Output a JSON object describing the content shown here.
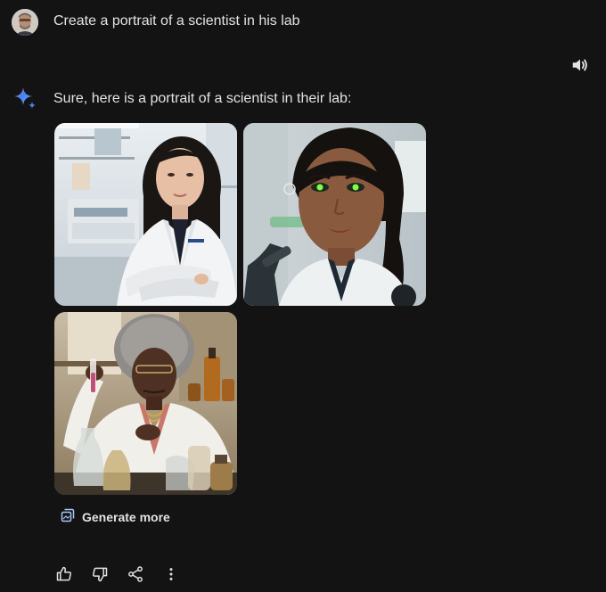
{
  "user": {
    "prompt": "Create a portrait of a scientist in his lab"
  },
  "response": {
    "text": "Sure, here is a portrait of a scientist in their lab:",
    "images": [
      {
        "description": "scientist-portrait-1"
      },
      {
        "description": "scientist-portrait-2"
      },
      {
        "description": "scientist-portrait-3"
      }
    ],
    "generate_more_label": "Generate more"
  },
  "icons": {
    "speaker": "speaker-icon",
    "gemini": "gemini-sparkle-icon",
    "generate_more": "image-stack-icon",
    "thumbs_up": "thumbs-up-icon",
    "thumbs_down": "thumbs-down-icon",
    "share": "share-icon",
    "more": "more-vertical-icon"
  },
  "colors": {
    "background": "#131314",
    "text": "#e3e3e3",
    "accent_blue": "#4285f4"
  }
}
